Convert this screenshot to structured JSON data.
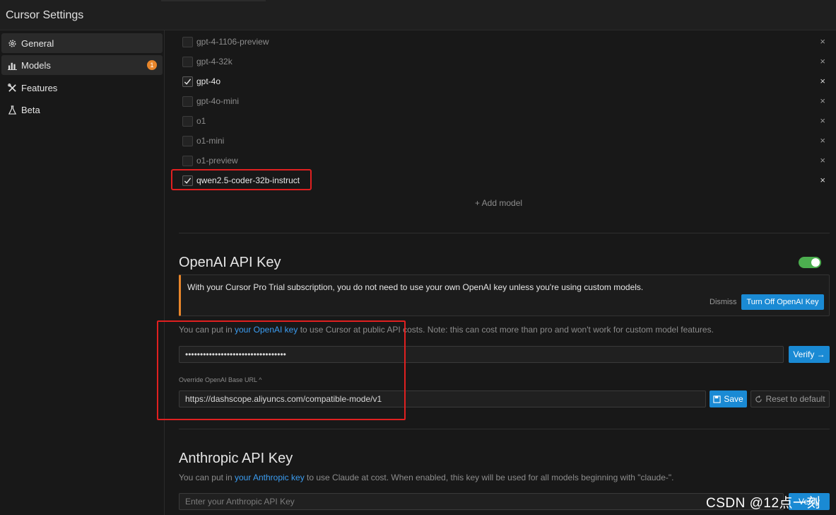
{
  "window": {
    "title": "Cursor Settings"
  },
  "sidebar": {
    "items": [
      {
        "label": "General",
        "icon": "gear-icon"
      },
      {
        "label": "Models",
        "icon": "bar-chart-icon",
        "badge": "1"
      },
      {
        "label": "Features",
        "icon": "tools-icon"
      },
      {
        "label": "Beta",
        "icon": "flask-icon"
      }
    ]
  },
  "models": {
    "list": [
      {
        "name": "gpt-4-1106-preview",
        "checked": false
      },
      {
        "name": "gpt-4-32k",
        "checked": false
      },
      {
        "name": "gpt-4o",
        "checked": true
      },
      {
        "name": "gpt-4o-mini",
        "checked": false
      },
      {
        "name": "o1",
        "checked": false
      },
      {
        "name": "o1-mini",
        "checked": false
      },
      {
        "name": "o1-preview",
        "checked": false
      },
      {
        "name": "qwen2.5-coder-32b-instruct",
        "checked": true
      }
    ],
    "remove_glyph": "×",
    "add_model_label": "+ Add model"
  },
  "openai": {
    "title": "OpenAI API Key",
    "enabled": true,
    "notice": "With your Cursor Pro Trial subscription, you do not need to use your own OpenAI key unless you're using custom models.",
    "dismiss_label": "Dismiss",
    "turn_off_label": "Turn Off OpenAI Key",
    "help_prefix": "You can put in ",
    "help_link": "your OpenAI key",
    "help_suffix": " to use Cursor at public API costs. Note: this can cost more than pro and won't work for custom model features.",
    "key_value": "••••••••••••••••••••••••••••••••••",
    "verify_label": "Verify →",
    "override_label": "Override OpenAI Base URL ^",
    "base_url": "https://dashscope.aliyuncs.com/compatible-mode/v1",
    "save_label": "Save",
    "reset_label": "Reset to default"
  },
  "anthropic": {
    "title": "Anthropic API Key",
    "help_prefix": "You can put in ",
    "help_link": "your Anthropic key",
    "help_suffix": " to use Claude at cost. When enabled, this key will be used for all models beginning with \"claude-\".",
    "placeholder": "Enter your Anthropic API Key",
    "verify_label": "Verify"
  },
  "watermark": "CSDN @12点一刻",
  "colors": {
    "accent": "#1a8ad4",
    "toggle_on": "#4cae4f",
    "badge": "#e8862b",
    "highlight": "#e02020"
  }
}
